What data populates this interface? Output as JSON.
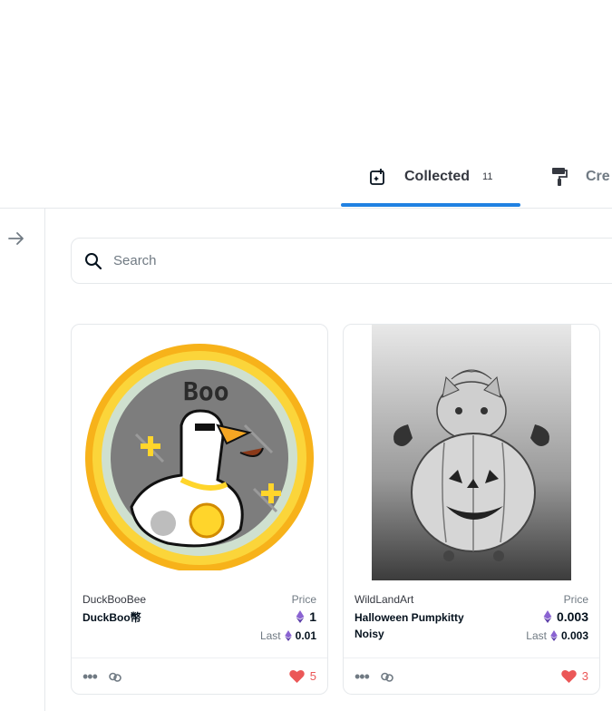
{
  "tabs": [
    {
      "label": "Collected",
      "count": "11",
      "icon": "nft-collected-icon"
    },
    {
      "label": "Cre",
      "icon": "paint-roller-icon"
    }
  ],
  "search": {
    "placeholder": "Search"
  },
  "cards": [
    {
      "collection": "DuckBooBee",
      "name": "DuckBoo幣",
      "price_label": "Price",
      "price": "1",
      "last_label": "Last",
      "last_price": "0.01",
      "likes": "5",
      "image_icon": "duck-coin-pixel-art"
    },
    {
      "collection": "WildLandArt",
      "name": "Halloween Pumpkitty Noisy",
      "price_label": "Price",
      "price": "0.003",
      "last_label": "Last",
      "last_price": "0.003",
      "likes": "3",
      "image_icon": "pumpkin-cat-artwork"
    }
  ],
  "colors": {
    "accent": "#2081e2",
    "heart": "#eb5757",
    "eth": "#8a63d2"
  }
}
